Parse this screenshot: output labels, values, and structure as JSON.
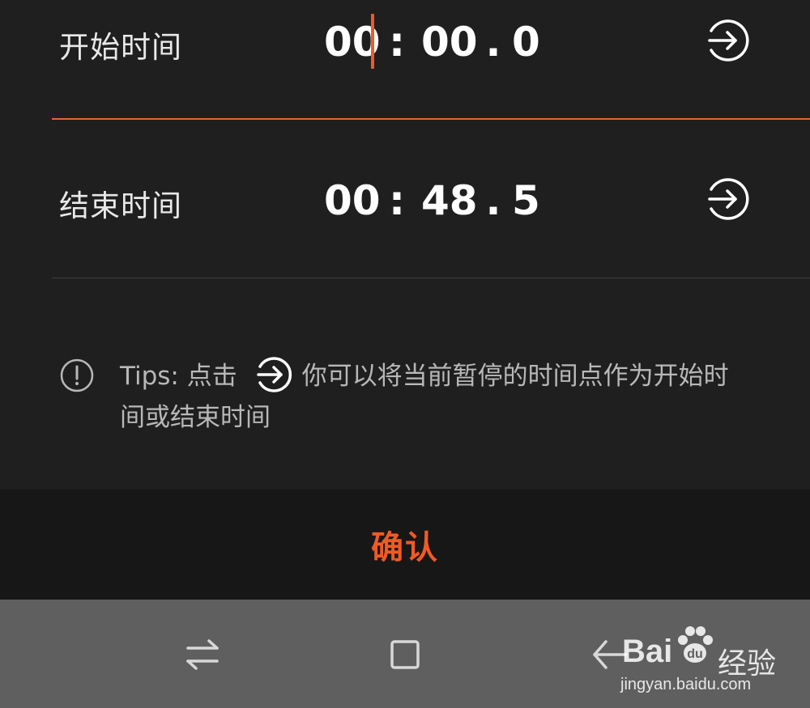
{
  "start_row": {
    "label": "开始时间",
    "minutes": "00",
    "colon": ":",
    "seconds": "00",
    "dot": ".",
    "fraction": "0"
  },
  "end_row": {
    "label": "结束时间",
    "minutes": "00",
    "colon": ":",
    "seconds": "48",
    "dot": ".",
    "fraction": "5"
  },
  "tips": {
    "prefix": "Tips: 点击",
    "suffix": "你可以将当前暂停的时间点作为开始时间或结束时间"
  },
  "confirm": {
    "label": "确认"
  },
  "watermark": {
    "logo": "Bai",
    "suffix": "经验",
    "url": "jingyan.baidu.com"
  },
  "colors": {
    "accent": "#f15a24",
    "background": "#1f1f1f",
    "navbar": "#5f5f5f"
  },
  "icons": {
    "start_set": "arrow-in-circle-icon",
    "end_set": "arrow-in-circle-icon",
    "tips": "info-circle-icon",
    "nav_recent": "swap-arrows-icon",
    "nav_home": "square-home-icon",
    "nav_back": "back-arrow-icon"
  }
}
